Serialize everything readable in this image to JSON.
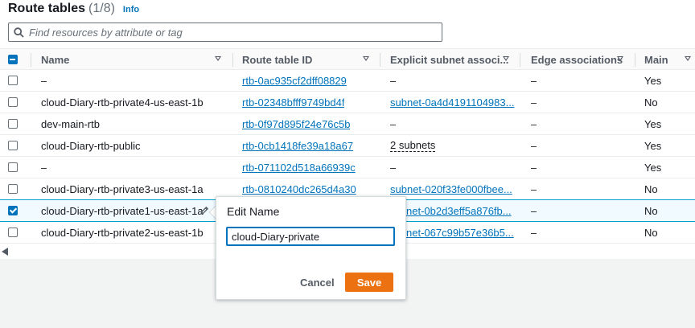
{
  "header": {
    "title": "Route tables",
    "count": "(1/8)",
    "info_link": "Info"
  },
  "search": {
    "placeholder": "Find resources by attribute or tag"
  },
  "table": {
    "columns": [
      {
        "label": "Name"
      },
      {
        "label": "Route table ID"
      },
      {
        "label": "Explicit subnet associ..."
      },
      {
        "label": "Edge associations"
      },
      {
        "label": "Main"
      }
    ],
    "rows": [
      {
        "name": "–",
        "id": "rtb-0ac935cf2dff08829",
        "subnet": "–",
        "edge": "–",
        "main": "Yes",
        "checked": false
      },
      {
        "name": "cloud-Diary-rtb-private4-us-east-1b",
        "id": "rtb-02348bfff9749bd4f",
        "subnet": "subnet-0a4d4191104983...",
        "edge": "–",
        "main": "No",
        "checked": false
      },
      {
        "name": "dev-main-rtb",
        "id": "rtb-0f97d895f24e76c5b",
        "subnet": "–",
        "edge": "–",
        "main": "Yes",
        "checked": false
      },
      {
        "name": "cloud-Diary-rtb-public",
        "id": "rtb-0cb1418fe39a18a67",
        "subnet": "2 subnets",
        "edge": "–",
        "main": "Yes",
        "checked": false
      },
      {
        "name": "–",
        "id": "rtb-071102d518a66939c",
        "subnet": "–",
        "edge": "–",
        "main": "Yes",
        "checked": false
      },
      {
        "name": "cloud-Diary-rtb-private3-us-east-1a",
        "id": "rtb-0810240dc265d4a30",
        "subnet": "subnet-020f33fe000fbee...",
        "edge": "–",
        "main": "No",
        "checked": false
      },
      {
        "name": "cloud-Diary-rtb-private1-us-east-1a",
        "id": "",
        "subnet": "net-0b2d3eff5a876fb...",
        "edge": "–",
        "main": "No",
        "checked": true
      },
      {
        "name": "cloud-Diary-rtb-private2-us-east-1b",
        "id": "",
        "subnet": "net-067c99b57e36b5...",
        "edge": "–",
        "main": "No",
        "checked": false
      }
    ]
  },
  "popover": {
    "title": "Edit Name",
    "input_value": "cloud-Diary-private",
    "cancel_label": "Cancel",
    "save_label": "Save"
  },
  "colors": {
    "link": "#0073bb",
    "save_button": "#ec7211",
    "selected_row_border": "#00a1c9"
  },
  "icons": [
    "search-icon",
    "sort-caret-icon",
    "pencil-icon",
    "scroll-left-icon"
  ]
}
